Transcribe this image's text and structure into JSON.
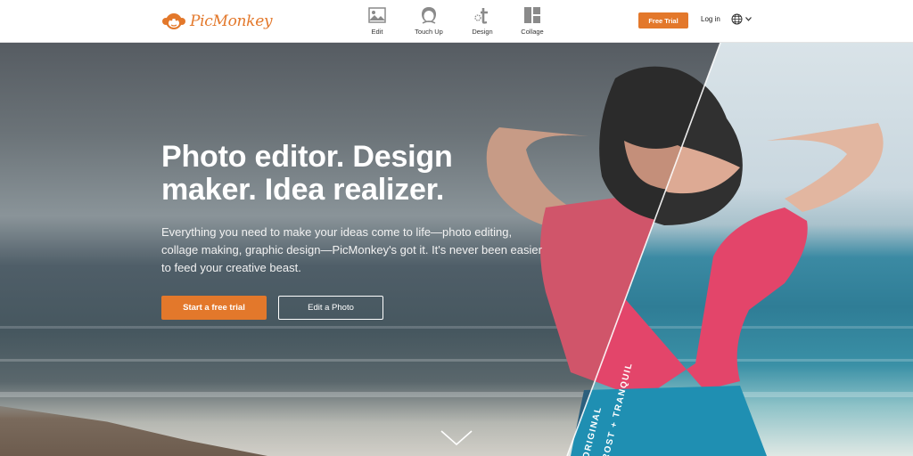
{
  "header": {
    "logo_text": "PicMonkey",
    "nav": [
      {
        "label": "Edit",
        "icon": "photo-icon"
      },
      {
        "label": "Touch Up",
        "icon": "face-icon"
      },
      {
        "label": "Design",
        "icon": "design-icon"
      },
      {
        "label": "Collage",
        "icon": "collage-icon"
      }
    ],
    "free_trial_label": "Free Trial",
    "login_label": "Log in",
    "language_icon": "globe-icon"
  },
  "hero": {
    "headline": "Photo editor. Design maker. Idea realizer.",
    "subtext": "Everything you need to make your ideas come to life—photo editing, collage making, graphic design—PicMonkey's got it. It's never been easier to feed your creative beast.",
    "primary_cta": "Start a free trial",
    "secondary_cta": "Edit a Photo",
    "filter_label_left": "ORIGINAL",
    "filter_label_right": "FROST + TRANQUIL",
    "scroll_icon": "chevron-down-icon"
  },
  "colors": {
    "brand_orange": "#e3782b",
    "white": "#ffffff"
  }
}
